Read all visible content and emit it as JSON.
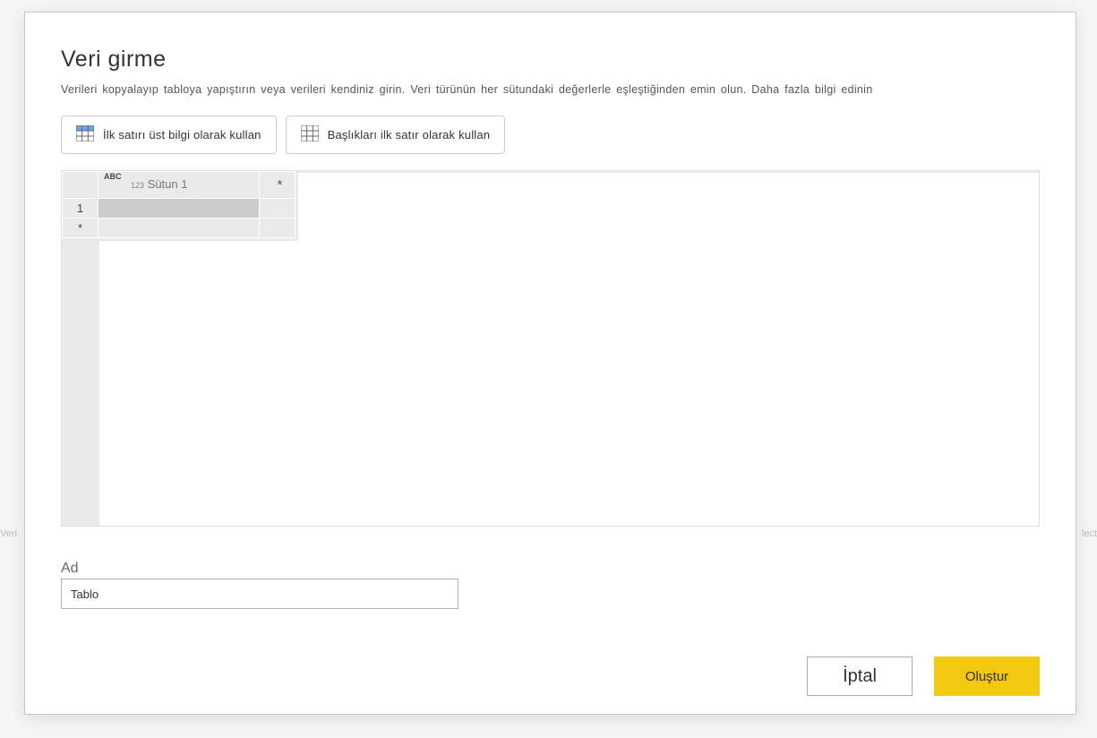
{
  "bg": {
    "left_fragment": "Veri",
    "right_fragment": "lect"
  },
  "dialog": {
    "title": "Veri girme",
    "description": "Verileri kopyalayıp tabloya yapıştırın veya verileri kendiniz girin. Veri türünün her sütundaki değerlerle eşleştiğinden emin olun.",
    "more_link": "Daha fazla bilgi edinin"
  },
  "toolbar": {
    "use_first_row_headers": "İlk satırı üst bilgi olarak kullan",
    "use_headers_first_row": "Başlıkları ilk satır olarak kullan"
  },
  "grid": {
    "column_type_abc": "ABC",
    "column_type_123": "123",
    "column_name": "Sütun 1",
    "add_column_symbol": "*",
    "row1_label": "1",
    "add_row_symbol": "*"
  },
  "name_field": {
    "label": "Ad",
    "value": "Tablo"
  },
  "footer": {
    "cancel": "İptal",
    "create": "Oluştur"
  }
}
